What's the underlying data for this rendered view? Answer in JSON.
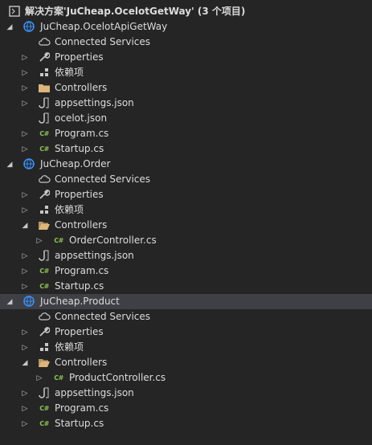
{
  "solution": {
    "label": "解决方案'JuCheap.OcelotGetWay' (3 个项目)"
  },
  "projects": [
    {
      "name": "JuCheap.OcelotApiGetWay",
      "items": {
        "connected_services": "Connected Services",
        "properties": "Properties",
        "dependencies": "依赖项",
        "controllers": "Controllers",
        "appsettings": "appsettings.json",
        "ocelot": "ocelot.json",
        "program": "Program.cs",
        "startup": "Startup.cs"
      }
    },
    {
      "name": "JuCheap.Order",
      "items": {
        "connected_services": "Connected Services",
        "properties": "Properties",
        "dependencies": "依赖项",
        "controllers": "Controllers",
        "controller_file": "OrderController.cs",
        "appsettings": "appsettings.json",
        "program": "Program.cs",
        "startup": "Startup.cs"
      }
    },
    {
      "name": "JuCheap.Product",
      "items": {
        "connected_services": "Connected Services",
        "properties": "Properties",
        "dependencies": "依赖项",
        "controllers": "Controllers",
        "controller_file": "ProductController.cs",
        "appsettings": "appsettings.json",
        "program": "Program.cs",
        "startup": "Startup.cs"
      }
    }
  ],
  "icons": {
    "csharp_badge": "C#"
  },
  "colors": {
    "background": "#252526",
    "selection": "#3f3f46",
    "text": "#dcdcdc",
    "folder": "#dcb67a",
    "csharp": "#8dc351",
    "project": "#3794ff"
  }
}
